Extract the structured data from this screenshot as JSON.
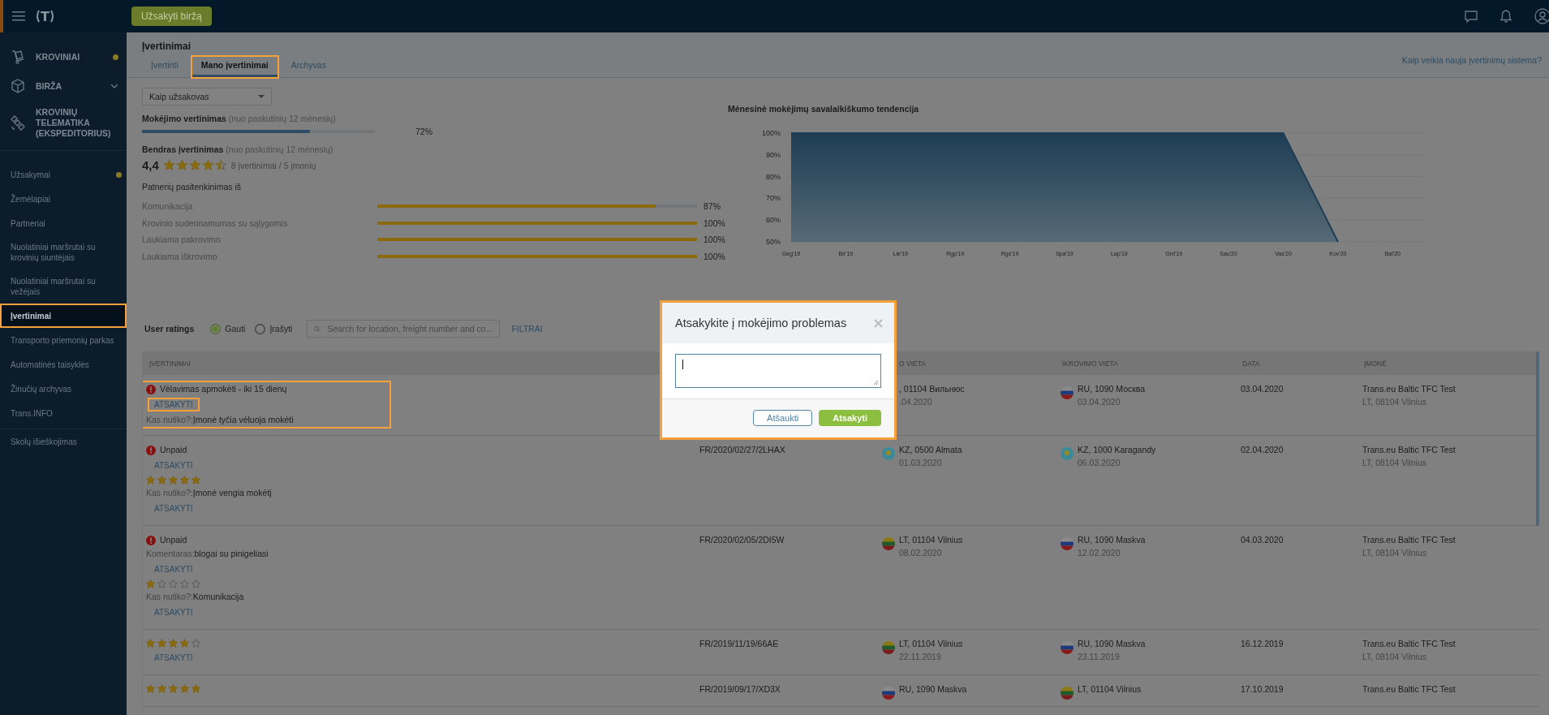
{
  "topbar": {
    "logo": "T",
    "order_button": "Užsakyti biržą"
  },
  "sidebar": {
    "modules": [
      {
        "label": "KROVINIAI",
        "dot": true,
        "expandable": false
      },
      {
        "label": "BIRŽA",
        "dot": false,
        "expandable": true
      },
      {
        "label": "KROVINIŲ TELEMATIKA (EKSPEDITORIUS)",
        "dot": false,
        "expandable": false
      }
    ],
    "items": [
      {
        "label": "Užsakymai",
        "dot": true,
        "selected": false,
        "highlighted": false
      },
      {
        "label": "Žemėlapiai",
        "dot": false,
        "selected": false,
        "highlighted": false
      },
      {
        "label": "Partneriai",
        "dot": false,
        "selected": false,
        "highlighted": false
      },
      {
        "label": "Nuolatiniai maršrutai su krovinių siuntėjais",
        "dot": false,
        "selected": false,
        "highlighted": false
      },
      {
        "label": "Nuolatiniai maršrutai su vežėjais",
        "dot": false,
        "selected": false,
        "highlighted": false
      },
      {
        "label": "Įvertinimai",
        "dot": false,
        "selected": true,
        "highlighted": true
      },
      {
        "label": "Transporto priemonių parkas",
        "dot": false,
        "selected": false,
        "highlighted": false
      },
      {
        "label": "Automatinės taisyklės",
        "dot": false,
        "selected": false,
        "highlighted": false
      },
      {
        "label": "Žinučių archyvas",
        "dot": false,
        "selected": false,
        "highlighted": false
      },
      {
        "label": "Trans.INFO",
        "dot": false,
        "selected": false,
        "highlighted": false
      }
    ],
    "footer_items": [
      {
        "label": "Skolų išieškojimas",
        "selected": false
      }
    ]
  },
  "page": {
    "title": "Įvertinimai",
    "tabs": [
      {
        "label": "Įvertinti",
        "selected": false,
        "highlighted": false
      },
      {
        "label": "Mano įvertinimai",
        "selected": true,
        "highlighted": true
      },
      {
        "label": "Archyvas",
        "selected": false,
        "highlighted": false
      }
    ],
    "help_link": "Kaip veikia nauja įvertinimų sistema?"
  },
  "role_select": {
    "value": "Kaip užsakovas"
  },
  "payment_rating": {
    "title": "Mokėjimo vertinimas",
    "period": "(nuo paskutinių 12 mėnesių)",
    "level": 0.72,
    "reading": "72%"
  },
  "overall_rating": {
    "title": "Bendras įvertinimas",
    "period": "(nuo paskutinių 12 mėnesių)",
    "score": "4,4",
    "stars": 4.5,
    "summary": "8 įvertinimai / 5 įmonių"
  },
  "satisfaction": {
    "title": "Patnerių pasitenkinimas iš",
    "criteria": [
      {
        "name": "Komunikacija",
        "level": 0.87,
        "reading": "87%"
      },
      {
        "name": "Krovinio suderinamumas su sąlygomis",
        "level": 1,
        "reading": "100%"
      },
      {
        "name": "Laukiama pakrovimo",
        "level": 1,
        "reading": "100%"
      },
      {
        "name": "Laukiama iškrovimo",
        "level": 1,
        "reading": "100%"
      }
    ]
  },
  "trend": {
    "chart_data": {
      "type": "area",
      "title": "Mėnesinė mokėjimų savalaikiškumo tendencija",
      "grid": true,
      "categories": [
        "Geg'19",
        "Bir'19",
        "Lie'19",
        "Rgp'19",
        "Rgs'19",
        "Spa'19",
        "Lap'19",
        "Grd'19",
        "Sau'20",
        "Vas'20",
        "Kov'20",
        "Bal'20"
      ],
      "series": [
        {
          "color": "#1e3d55",
          "values": [
            100,
            100,
            100,
            100,
            100,
            100,
            100,
            100,
            100,
            100,
            50,
            null
          ]
        }
      ],
      "ylim": [
        50,
        100
      ],
      "yticks": [
        {
          "value": 50,
          "label": "50%"
        },
        {
          "value": 60,
          "label": "60%"
        },
        {
          "value": 70,
          "label": "70%"
        },
        {
          "value": 80,
          "label": "80%"
        },
        {
          "value": 90,
          "label": "90%"
        },
        {
          "value": 100,
          "label": "100%"
        }
      ]
    }
  },
  "ratings": {
    "title": "User ratings",
    "filters": [
      {
        "label": "Gauti",
        "selected": true
      },
      {
        "label": "Įrašyti",
        "selected": false
      }
    ],
    "search": {
      "placeholder": "Search for location, freight number and co..."
    },
    "filter_link": "FILTRAI",
    "table": {
      "header": {
        "column_1": "ĮVERTINIMAI",
        "column_3": "O VIETA",
        "column_4": "IKROVIMO VIETA",
        "column_5": "DATA",
        "column_6": "ĮMONĖ"
      },
      "rows": [
        {
          "highlighted": true,
          "items": [
            {
              "kind": "issue",
              "text": "Vėlavimas apmokėti - iki 15 dienų"
            },
            {
              "kind": "reply",
              "label": "ATSAKYTI",
              "highlighted": true
            },
            {
              "kind": "note",
              "label": "Kas nutiko?:",
              "text": "Įmonė tyčia vėluoja mokėti"
            }
          ],
          "loading": {
            "place": ", 01104 Вильнюс",
            "date": ".04.2020"
          },
          "unloading": {
            "kind": "ru",
            "place": "RU, 1090 Москва",
            "date": "03.04.2020"
          },
          "date": "03.04.2020",
          "company": {
            "name": "Trans.eu Baltic TFC Test",
            "address": "LT, 08104 Vilnius"
          }
        },
        {
          "highlighted": false,
          "items": [
            {
              "kind": "issue",
              "text": "Unpaid"
            },
            {
              "kind": "reply",
              "label": "ATSAKYTI",
              "highlighted": false
            },
            {
              "kind": "stars",
              "stars": 5
            },
            {
              "kind": "note",
              "label": "Kas nutiko?:",
              "text": "Įmonė vengia mokėtį"
            },
            {
              "kind": "reply",
              "label": "ATSAKYTI",
              "highlighted": false
            }
          ],
          "freight": "FR/2020/02/27/2LHAX",
          "loading": {
            "kind": "kz",
            "place": "KZ, 0500 Almata",
            "date": "01.03.2020"
          },
          "unloading": {
            "kind": "kz",
            "place": "KZ, 1000 Karagandy",
            "date": "06.03.2020"
          },
          "date": "02.04.2020",
          "company": {
            "name": "Trans.eu Baltic TFC Test",
            "address": "LT, 08104 Vilnius"
          }
        },
        {
          "highlighted": false,
          "items": [
            {
              "kind": "issue",
              "text": "Unpaid"
            },
            {
              "kind": "note",
              "label": "Komentaras:",
              "text": "blogai su pinigeliasi"
            },
            {
              "kind": "reply",
              "label": "ATSAKYTI",
              "highlighted": false
            },
            {
              "kind": "stars",
              "stars": 1
            },
            {
              "kind": "note",
              "label": "Kas nutiko?:",
              "text": "Komunikacija"
            },
            {
              "kind": "reply",
              "label": "ATSAKYTI",
              "highlighted": false
            }
          ],
          "freight": "FR/2020/02/05/2DI5W",
          "loading": {
            "kind": "lt",
            "place": "LT, 01104 Vilnius",
            "date": "08.02.2020"
          },
          "unloading": {
            "kind": "ru",
            "place": "RU, 1090 Maskva",
            "date": "12.02.2020"
          },
          "date": "04.03.2020",
          "company": {
            "name": "Trans.eu Baltic TFC Test",
            "address": "LT, 08104 Vilnius"
          }
        },
        {
          "highlighted": false,
          "items": [
            {
              "kind": "stars",
              "stars": 4
            },
            {
              "kind": "reply",
              "label": "ATSAKYTI",
              "highlighted": false
            }
          ],
          "freight": "FR/2019/11/19/66AE",
          "loading": {
            "kind": "lt",
            "place": "LT, 01104 Vilnius",
            "date": "22.11.2019"
          },
          "unloading": {
            "kind": "ru",
            "place": "RU, 1090 Maskva",
            "date": "23.11.2019"
          },
          "date": "16.12.2019",
          "company": {
            "name": "Trans.eu Baltic TFC Test",
            "address": "LT, 08104 Vilnius"
          }
        },
        {
          "highlighted": false,
          "items": [
            {
              "kind": "stars",
              "stars": 5
            }
          ],
          "freight": "FR/2019/09/17/XD3X",
          "loading": {
            "kind": "ru",
            "place": "RU, 1090 Maskva"
          },
          "unloading": {
            "kind": "lt",
            "place": "LT, 01104 Vilnius"
          },
          "date": "17.10.2019",
          "company": {
            "name": "Trans.eu Baltic TFC Test"
          }
        }
      ]
    }
  },
  "modal": {
    "title": "Atsakykite į mokėjimo problemas",
    "cancel": "Atšaukti",
    "submit": "Atsakyti"
  }
}
